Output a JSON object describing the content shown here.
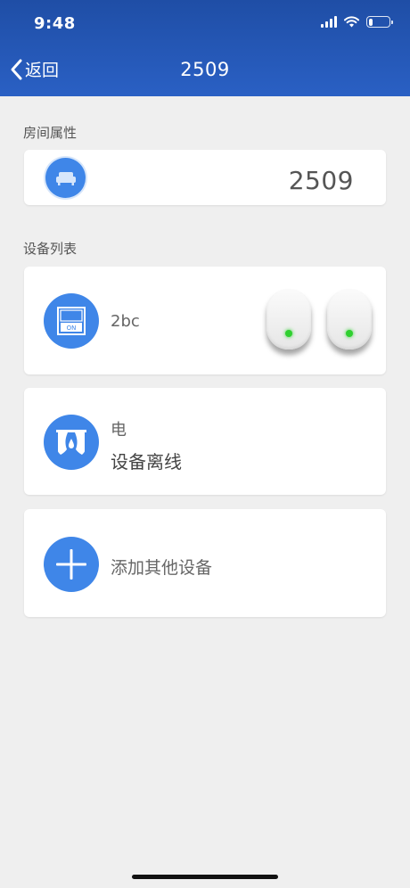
{
  "status_bar": {
    "time": "9:48"
  },
  "nav": {
    "back_label": "返回",
    "title": "2509"
  },
  "room_section": {
    "label": "房间属性",
    "room_number": "2509"
  },
  "device_section": {
    "label": "设备列表",
    "devices": [
      {
        "name": "2bc",
        "icon": "switch-on-icon",
        "switch_count": 2
      },
      {
        "name": "电",
        "status": "设备离线",
        "icon": "curtain-icon"
      }
    ],
    "add_label": "添加其他设备"
  },
  "colors": {
    "header": "#2a60c4",
    "icon_bg": "#3f86e8",
    "led": "#2fd02f",
    "page_bg": "#efefef"
  }
}
